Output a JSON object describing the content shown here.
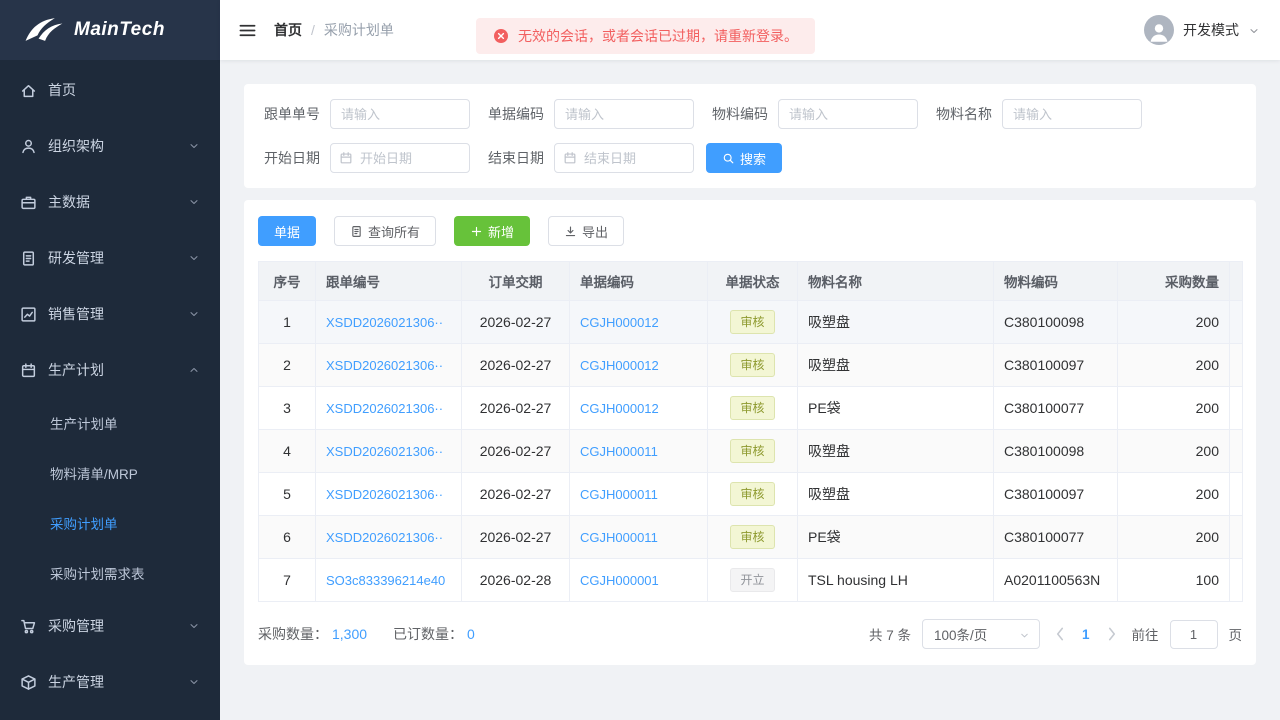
{
  "app": {
    "logo_text": "MainTech"
  },
  "colors": {
    "accent": "#409eff",
    "success": "#67c23a",
    "danger": "#f25f5f",
    "sidebar-bg": "#1e2a3a",
    "sidebar-logo-bg": "#273449",
    "alert-bg": "#fdecec",
    "tag-review-bg": "#f3f6d4",
    "tag-review-text": "#8e9a2f",
    "tag-open-bg": "#f4f4f5",
    "tag-open-text": "#909399"
  },
  "sidebar": {
    "items": [
      {
        "name": "home",
        "label": "首页",
        "icon": "home-icon",
        "expandable": false,
        "expanded": false
      },
      {
        "name": "organization",
        "label": "组织架构",
        "icon": "user-icon",
        "expandable": true,
        "expanded": false
      },
      {
        "name": "master-data",
        "label": "主数据",
        "icon": "briefcase-icon",
        "expandable": true,
        "expanded": false
      },
      {
        "name": "rd-management",
        "label": "研发管理",
        "icon": "document-icon",
        "expandable": true,
        "expanded": false
      },
      {
        "name": "sales-management",
        "label": "销售管理",
        "icon": "chart-icon",
        "expandable": true,
        "expanded": false
      },
      {
        "name": "production-plan",
        "label": "生产计划",
        "icon": "calendar-icon",
        "expandable": true,
        "expanded": true,
        "children": [
          {
            "name": "production-plan-order",
            "label": "生产计划单",
            "active": false
          },
          {
            "name": "bom-mrp",
            "label": "物料清单/MRP",
            "active": false
          },
          {
            "name": "purchase-plan-order",
            "label": "采购计划单",
            "active": true
          },
          {
            "name": "purchase-plan-demand",
            "label": "采购计划需求表",
            "active": false
          }
        ]
      },
      {
        "name": "purchase-management",
        "label": "采购管理",
        "icon": "cart-icon",
        "expandable": true,
        "expanded": false
      },
      {
        "name": "production-management",
        "label": "生产管理",
        "icon": "box-icon",
        "expandable": true,
        "expanded": false
      }
    ]
  },
  "header": {
    "breadcrumb": [
      "首页",
      "采购计划单"
    ],
    "breadcrumb_separator": "/",
    "alert_text": "无效的会话，或者会话已过期，请重新登录。",
    "user_mode": "开发模式"
  },
  "filters": {
    "text_fields": [
      {
        "name": "order-no",
        "label": "跟单单号",
        "placeholder": "请输入"
      },
      {
        "name": "doc-no",
        "label": "单据编码",
        "placeholder": "请输入"
      },
      {
        "name": "material-code",
        "label": "物料编码",
        "placeholder": "请输入"
      },
      {
        "name": "material-name",
        "label": "物料名称",
        "placeholder": "请输入"
      }
    ],
    "date_fields": [
      {
        "name": "start-date",
        "label": "开始日期",
        "placeholder": "开始日期"
      },
      {
        "name": "end-date",
        "label": "结束日期",
        "placeholder": "结束日期"
      }
    ],
    "search_label": "搜索"
  },
  "toolbar": {
    "buttons": [
      {
        "name": "bill-button",
        "label": "单据",
        "type": "primary",
        "icon": null
      },
      {
        "name": "query-all-button",
        "label": "查询所有",
        "type": "default",
        "icon": "document-icon"
      },
      {
        "name": "add-button",
        "label": "新增",
        "type": "success",
        "icon": "plus-icon"
      },
      {
        "name": "export-button",
        "label": "导出",
        "type": "default",
        "icon": "download-icon"
      }
    ]
  },
  "table": {
    "columns": [
      {
        "label": "序号",
        "align": "center"
      },
      {
        "label": "跟单编号",
        "align": "left"
      },
      {
        "label": "订单交期",
        "align": "center"
      },
      {
        "label": "单据编码",
        "align": "left"
      },
      {
        "label": "单据状态",
        "align": "center"
      },
      {
        "label": "物料名称",
        "align": "left"
      },
      {
        "label": "物料编码",
        "align": "left"
      },
      {
        "label": "采购数量",
        "align": "right"
      }
    ],
    "rows": [
      {
        "seq": "1",
        "order_no": "XSDD2026021306··",
        "delivery_date": "2026-02-27",
        "doc_no": "CGJH000012",
        "status": "审核",
        "status_type": "review",
        "material_name": "吸塑盘",
        "material_code": "C380100098",
        "qty": "200"
      },
      {
        "seq": "2",
        "order_no": "XSDD2026021306··",
        "delivery_date": "2026-02-27",
        "doc_no": "CGJH000012",
        "status": "审核",
        "status_type": "review",
        "material_name": "吸塑盘",
        "material_code": "C380100097",
        "qty": "200"
      },
      {
        "seq": "3",
        "order_no": "XSDD2026021306··",
        "delivery_date": "2026-02-27",
        "doc_no": "CGJH000012",
        "status": "审核",
        "status_type": "review",
        "material_name": "PE袋",
        "material_code": "C380100077",
        "qty": "200"
      },
      {
        "seq": "4",
        "order_no": "XSDD2026021306··",
        "delivery_date": "2026-02-27",
        "doc_no": "CGJH000011",
        "status": "审核",
        "status_type": "review",
        "material_name": "吸塑盘",
        "material_code": "C380100098",
        "qty": "200"
      },
      {
        "seq": "5",
        "order_no": "XSDD2026021306··",
        "delivery_date": "2026-02-27",
        "doc_no": "CGJH000011",
        "status": "审核",
        "status_type": "review",
        "material_name": "吸塑盘",
        "material_code": "C380100097",
        "qty": "200"
      },
      {
        "seq": "6",
        "order_no": "XSDD2026021306··",
        "delivery_date": "2026-02-27",
        "doc_no": "CGJH000011",
        "status": "审核",
        "status_type": "review",
        "material_name": "PE袋",
        "material_code": "C380100077",
        "qty": "200"
      },
      {
        "seq": "7",
        "order_no": "SO3c833396214e40",
        "delivery_date": "2026-02-28",
        "doc_no": "CGJH000001",
        "status": "开立",
        "status_type": "open",
        "material_name": "TSL housing LH",
        "material_code": "A0201100563N",
        "qty": "100"
      }
    ]
  },
  "summary": {
    "purchase_qty_label": "采购数量：",
    "purchase_qty": "1,300",
    "ordered_qty_label": "已订数量：",
    "ordered_qty": "0"
  },
  "pagination": {
    "total": "共 7 条",
    "page_size": "100条/页",
    "current_page": "1",
    "goto_label": "前往",
    "goto_value": "1",
    "page_suffix_label": "页"
  }
}
